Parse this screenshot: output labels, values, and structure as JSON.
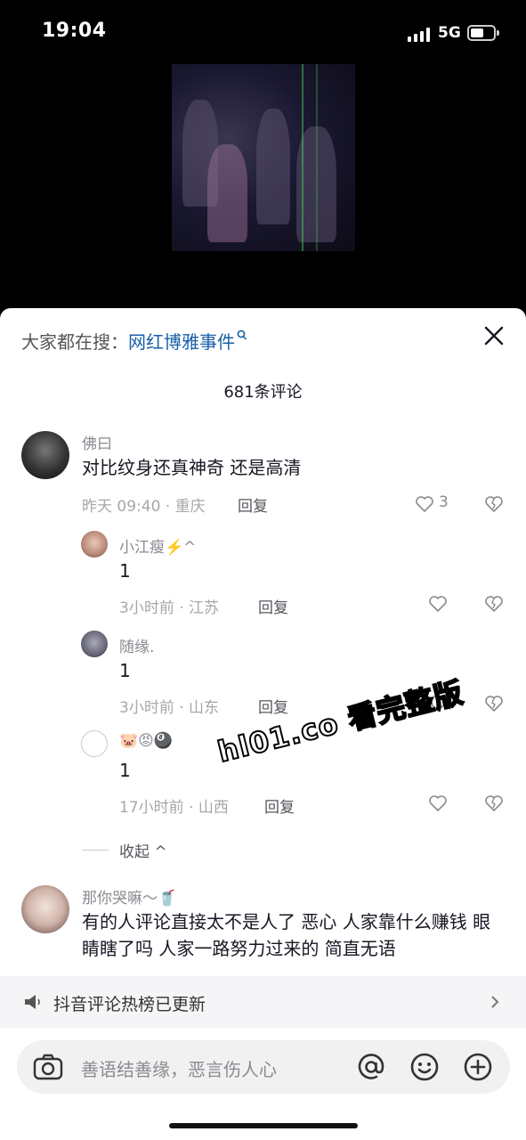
{
  "status_bar": {
    "time": "19:04",
    "network": "5G"
  },
  "search": {
    "prefix": "大家都在搜：",
    "keyword": "网红博雅事件"
  },
  "comments_header": {
    "count_label": "681条评论"
  },
  "comments": [
    {
      "user": "佛曰",
      "text": "对比纹身还真神奇 还是高清",
      "meta": "昨天 09:40 · 重庆",
      "reply_label": "回复",
      "likes": "3"
    },
    {
      "user": "那你哭嘛～🥤",
      "text": "有的人评论直接太不是人了 恶心 人家靠什么赚钱 眼睛瞎了吗 人家一路努力过来的 简直无语"
    }
  ],
  "replies": [
    {
      "user": "小江瘦⚡️^",
      "text": "1",
      "meta": "3小时前 · 江苏",
      "reply_label": "回复"
    },
    {
      "user": "随缘.",
      "text": "1",
      "meta": "3小时前 · 山东",
      "reply_label": "回复"
    },
    {
      "user": "🐷😡🎱",
      "text": "1",
      "meta": "17小时前 · 山西",
      "reply_label": "回复"
    }
  ],
  "collapse_label": "收起 ^",
  "watermark": "hl01.co 看完整版",
  "hot_bar": {
    "text": "抖音评论热榜已更新"
  },
  "input": {
    "placeholder": "善语结善缘，恶言伤人心"
  },
  "icons": [
    "search-icon",
    "close-icon",
    "heart-icon",
    "dislike-heart-icon",
    "speaker-icon",
    "chevron-right-icon",
    "camera-icon",
    "at-icon",
    "emoji-icon",
    "plus-icon"
  ]
}
